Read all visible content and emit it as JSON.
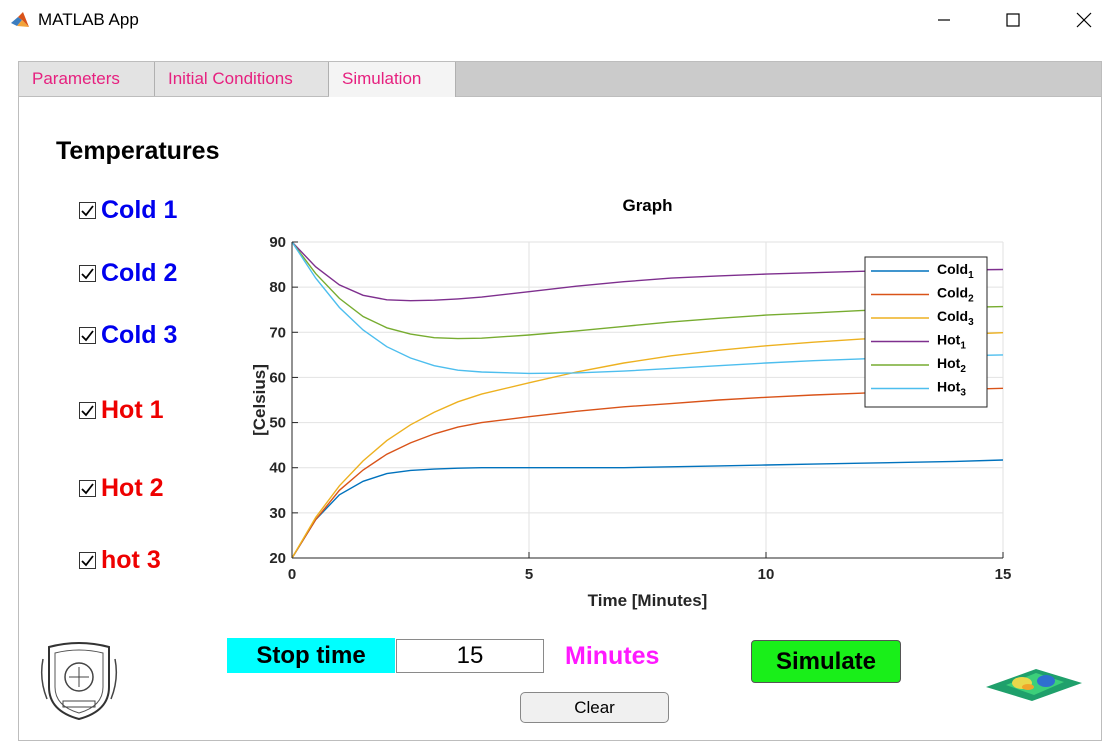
{
  "window": {
    "title": "MATLAB App",
    "icon": "matlab-icon"
  },
  "tabs": [
    {
      "label": "Parameters"
    },
    {
      "label": "Initial Conditions"
    },
    {
      "label": "Simulation",
      "active": true
    }
  ],
  "sidebar": {
    "heading": "Temperatures",
    "checkboxes": [
      {
        "label": "Cold 1",
        "checked": true,
        "color": "#0000ee"
      },
      {
        "label": "Cold 2",
        "checked": true,
        "color": "#0000ee"
      },
      {
        "label": "Cold 3",
        "checked": true,
        "color": "#0000ee"
      },
      {
        "label": "Hot 1",
        "checked": true,
        "color": "#ee0000"
      },
      {
        "label": "Hot 2",
        "checked": true,
        "color": "#ee0000"
      },
      {
        "label": "hot 3",
        "checked": true,
        "color": "#ee0000"
      }
    ]
  },
  "controls": {
    "stop_time_label": "Stop time",
    "stop_time_value": "15",
    "units_label": "Minutes",
    "simulate_label": "Simulate",
    "clear_label": "Clear"
  },
  "chart_data": {
    "type": "line",
    "title": "Graph",
    "xlabel": "Time [Minutes]",
    "ylabel": "[Celsius]",
    "xlim": [
      0,
      15
    ],
    "ylim": [
      20,
      90
    ],
    "xticks": [
      0,
      5,
      10,
      15
    ],
    "yticks": [
      20,
      30,
      40,
      50,
      60,
      70,
      80,
      90
    ],
    "grid": true,
    "legend_position": "top-right",
    "x": [
      0,
      0.5,
      1,
      1.5,
      2,
      2.5,
      3,
      3.5,
      4,
      5,
      6,
      7,
      8,
      9,
      10,
      11,
      12,
      13,
      14,
      15
    ],
    "series": [
      {
        "name": "Cold",
        "sub": "1",
        "color": "#0072bd",
        "values": [
          20,
          28.5,
          34,
          37,
          38.7,
          39.4,
          39.7,
          39.9,
          40,
          40,
          40,
          40,
          40.2,
          40.4,
          40.6,
          40.8,
          41,
          41.2,
          41.4,
          41.7
        ]
      },
      {
        "name": "Cold",
        "sub": "2",
        "color": "#d95319",
        "values": [
          20,
          28.5,
          35,
          39.5,
          43,
          45.5,
          47.5,
          49,
          50,
          51.3,
          52.5,
          53.5,
          54.2,
          55,
          55.6,
          56.1,
          56.5,
          57,
          57.3,
          57.6
        ]
      },
      {
        "name": "Cold",
        "sub": "3",
        "color": "#edb120",
        "values": [
          20,
          29,
          36,
          41.5,
          46,
          49.5,
          52.3,
          54.6,
          56.3,
          58.8,
          61.2,
          63.2,
          64.8,
          66,
          67,
          67.8,
          68.5,
          69,
          69.5,
          69.9
        ]
      },
      {
        "name": "Hot",
        "sub": "1",
        "color": "#7e2f8e",
        "values": [
          90,
          84.5,
          80.5,
          78.2,
          77.2,
          77,
          77.1,
          77.4,
          77.8,
          79,
          80.2,
          81.2,
          82,
          82.5,
          82.9,
          83.2,
          83.5,
          83.7,
          83.8,
          83.9
        ]
      },
      {
        "name": "Hot",
        "sub": "2",
        "color": "#77ac30",
        "values": [
          90,
          83,
          77.5,
          73.5,
          71,
          69.6,
          68.8,
          68.6,
          68.7,
          69.4,
          70.3,
          71.3,
          72.3,
          73.1,
          73.8,
          74.3,
          74.8,
          75.2,
          75.5,
          75.7
        ]
      },
      {
        "name": "Hot",
        "sub": "3",
        "color": "#4dbeee",
        "values": [
          90,
          82,
          75.5,
          70.5,
          66.8,
          64.3,
          62.6,
          61.6,
          61.2,
          60.9,
          61,
          61.4,
          62,
          62.6,
          63.2,
          63.7,
          64.1,
          64.5,
          64.8,
          65
        ]
      }
    ]
  }
}
